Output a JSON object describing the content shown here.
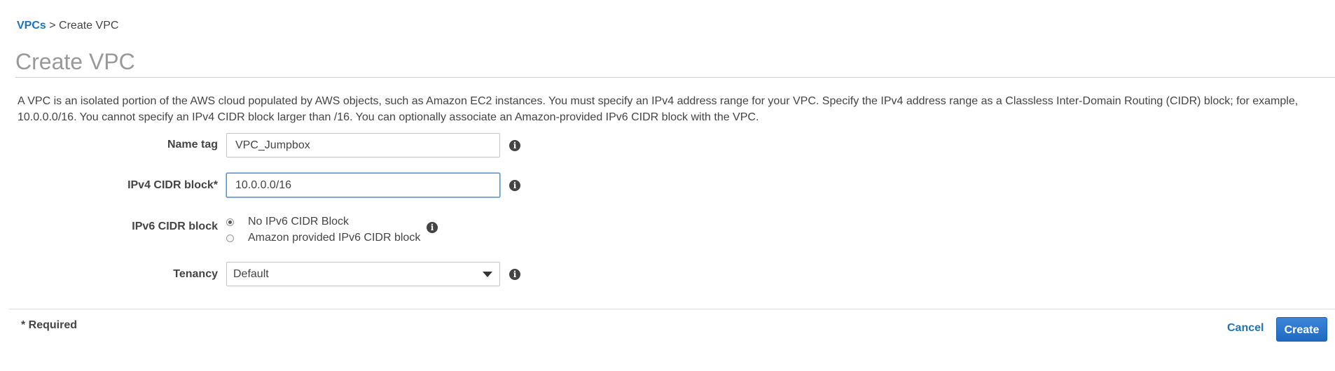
{
  "breadcrumb": {
    "link": "VPCs",
    "separator": ">",
    "current": "Create VPC"
  },
  "page_title": "Create VPC",
  "description": "A VPC is an isolated portion of the AWS cloud populated by AWS objects, such as Amazon EC2 instances. You must specify an IPv4 address range for your VPC. Specify the IPv4 address range as a Classless Inter-Domain Routing (CIDR) block; for example, 10.0.0.0/16. You cannot specify an IPv4 CIDR block larger than /16. You can optionally associate an Amazon-provided IPv6 CIDR block with the VPC.",
  "form": {
    "name_tag": {
      "label": "Name tag",
      "value": "VPC_Jumpbox"
    },
    "ipv4_cidr": {
      "label": "IPv4 CIDR block*",
      "value": "10.0.0.0/16",
      "focused": true
    },
    "ipv6_cidr": {
      "label": "IPv6 CIDR block",
      "options": [
        {
          "label": "No IPv6 CIDR Block",
          "checked": true
        },
        {
          "label": "Amazon provided IPv6 CIDR block",
          "checked": false
        }
      ]
    },
    "tenancy": {
      "label": "Tenancy",
      "selected": "Default"
    },
    "info_icon": "info-icon"
  },
  "footer": {
    "required_note": "* Required",
    "cancel_label": "Cancel",
    "create_label": "Create"
  },
  "colors": {
    "link": "#1e73be",
    "primary_button": "#1f69c2",
    "focus_border": "#4d90d6",
    "title": "#999999",
    "text": "#444444"
  }
}
